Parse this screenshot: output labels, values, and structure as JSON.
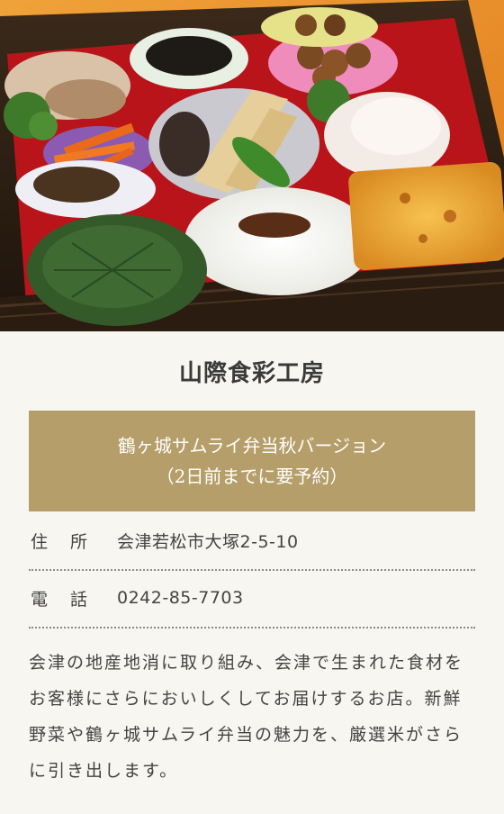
{
  "photo": {
    "alt": "bento-box-photo"
  },
  "shop": {
    "name": "山際食彩工房"
  },
  "menu": {
    "line1": "鶴ヶ城サムライ弁当秋バージョン",
    "line2": "（2日前までに要予約）"
  },
  "info": {
    "address_label": "住　所",
    "address_value": "会津若松市大塚2-5-10",
    "phone_label": "電　話",
    "phone_value": "0242-85-7703"
  },
  "description": {
    "text": "会津の地産地消に取り組み、会津で生まれた食材をお客様にさらにおいしくしてお届けするお店。新鮮野菜や鶴ヶ城サムライ弁当の魅力を、厳選米がさらに引き出します。"
  },
  "colors": {
    "background": "#f7f6f1",
    "banner": "#b59e6a",
    "text": "#444444"
  }
}
